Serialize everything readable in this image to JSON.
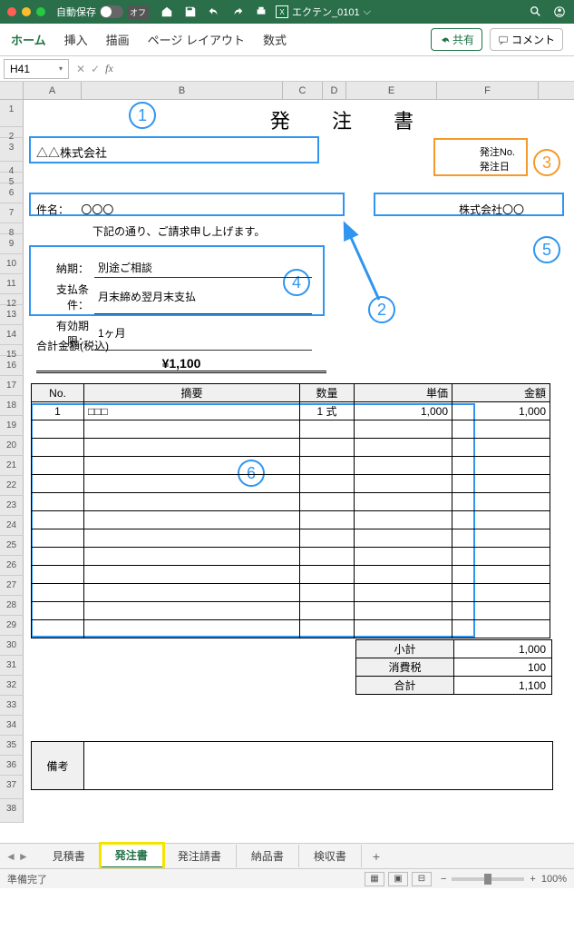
{
  "titlebar": {
    "autosave_label": "自動保存",
    "autosave_state": "オフ",
    "filename": "エクテン_0101"
  },
  "ribbon": {
    "tabs": [
      "ホーム",
      "挿入",
      "描画",
      "ページ レイアウト",
      "数式"
    ],
    "share": "共有",
    "comment": "コメント"
  },
  "formula": {
    "namebox": "H41",
    "fx": "fx"
  },
  "columns": [
    "A",
    "B",
    "C",
    "D",
    "E",
    "F"
  ],
  "rows": [
    "1",
    "2",
    "3",
    "4",
    "5",
    "6",
    "7",
    "8",
    "9",
    "10",
    "11",
    "12",
    "13",
    "14",
    "15",
    "16",
    "17",
    "18",
    "19",
    "20",
    "21",
    "22",
    "23",
    "24",
    "25",
    "26",
    "27",
    "28",
    "29",
    "30",
    "31",
    "32",
    "33",
    "34",
    "35",
    "36",
    "37",
    "38"
  ],
  "doc": {
    "title": "発 注 書",
    "company": "△△株式会社",
    "order_no_label": "発注No.",
    "order_date_label": "発注日",
    "subject_label": "件名：",
    "subject_value": "〇〇〇",
    "note": "下記の通り、ご請求申し上げます。",
    "supplier": "株式会社〇〇",
    "delivery_label": "納期：",
    "delivery_value": "別途ご相談",
    "payment_label": "支払条件：",
    "payment_value": "月末締め翌月末支払",
    "validity_label": "有効期限：",
    "validity_value": "1ヶ月",
    "total_label": "合計金額(税込)",
    "total_amount": "¥1,100",
    "headers": {
      "no": "No.",
      "desc": "摘要",
      "qty": "数量",
      "price": "単価",
      "amount": "金額"
    },
    "items": [
      {
        "no": "1",
        "desc": "□□□",
        "qty": "1 式",
        "price": "1,000",
        "amount": "1,000"
      }
    ],
    "subtotal_label": "小計",
    "subtotal": "1,000",
    "tax_label": "消費税",
    "tax": "100",
    "grand_label": "合計",
    "grand": "1,100",
    "remarks_label": "備考"
  },
  "annotations": {
    "1": "1",
    "2": "2",
    "3": "3",
    "4": "4",
    "5": "5",
    "6": "6"
  },
  "sheets": [
    "見積書",
    "発注書",
    "発注請書",
    "納品書",
    "検収書"
  ],
  "status": {
    "ready": "準備完了",
    "zoom": "100%"
  }
}
